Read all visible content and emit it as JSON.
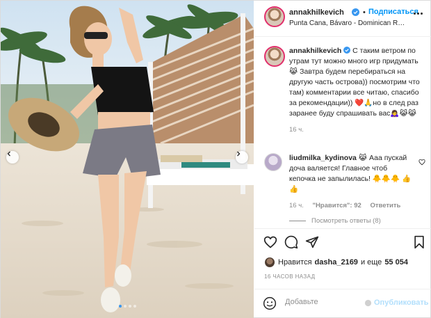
{
  "post": {
    "username": "annakhilkevich",
    "location": "Punta Cana, Bávaro - Dominican Repu...",
    "subscribe_dot": "•",
    "subscribe_label": "Подписаться",
    "caption": {
      "username": "annakhilkevich",
      "text": "С таким ветром по утрам тут можно много игр придумать 😹 Завтра будем перебираться на другую часть острова)) посмотрим что там) комментарии все читаю, спасибо за рекомендации)) ❤️🙏но в след раз заранее буду спрашивать вас🙇‍♀️😹😹",
      "time": "16 ч."
    },
    "reply": {
      "username": "liudmilka_kydinova",
      "text": "😹 Ааа пускай доча валяется! Главное чтоб кепочка не запылилась! 🐥🐥🐥 👍👍",
      "time": "16 ч.",
      "likes": "\"Нравится\": 92",
      "reply_label": "Ответить"
    },
    "view_replies": "Посмотреть ответы (8)",
    "likes_prefix": "Нравится",
    "likes_user": "dasha_2169",
    "likes_suffix": "и еще",
    "likes_count": "55 054",
    "timestamp": "16 ЧАСОВ НАЗАД",
    "comment_placeholder": "Добавьте",
    "publish_label": "Опубликовать"
  },
  "carousel": {
    "dots": 4,
    "active_index": 0
  },
  "icons": {
    "prev": "chevron-left-icon",
    "next": "chevron-right-icon",
    "like": "heart-icon",
    "comment": "comment-icon",
    "share": "paper-plane-icon",
    "save": "bookmark-icon",
    "emoji": "smiley-icon",
    "more": "more-horizontal-icon",
    "verified": "verified-badge-icon"
  },
  "colors": {
    "accent": "#0095f6",
    "muted": "#8e8e8e",
    "text": "#262626",
    "border": "#dbdbdb"
  }
}
